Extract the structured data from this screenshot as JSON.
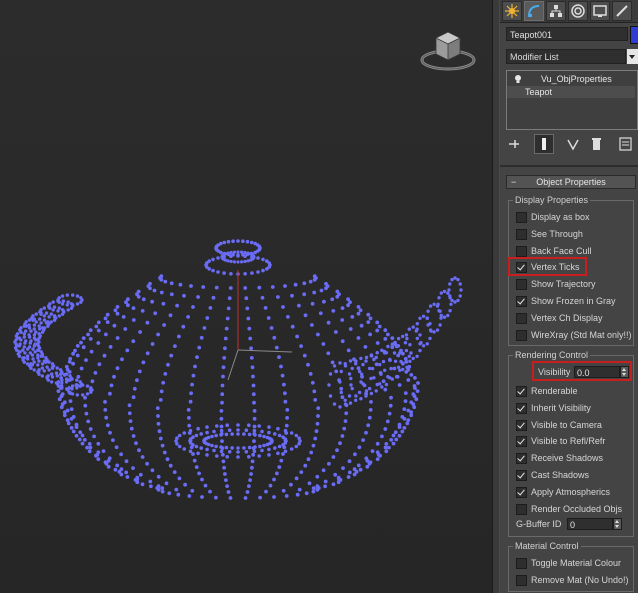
{
  "object": {
    "name": "Teapot001",
    "color": "#2f3dd6"
  },
  "modifier_list": {
    "label": "Modifier List"
  },
  "modifier_stack": {
    "items": [
      {
        "label": "Vu_ObjProperties"
      },
      {
        "label": "Teapot"
      }
    ]
  },
  "rollout": {
    "title": "Object Properties",
    "collapse_glyph": "−"
  },
  "display_properties": {
    "title": "Display Properties",
    "items": [
      {
        "label": "Display as box",
        "checked": false
      },
      {
        "label": "See Through",
        "checked": false
      },
      {
        "label": "Back Face Cull",
        "checked": false
      },
      {
        "label": "Vertex Ticks",
        "checked": true
      },
      {
        "label": "Show Trajectory",
        "checked": false
      },
      {
        "label": "Show Frozen in Gray",
        "checked": true
      },
      {
        "label": "Vertex Ch Display",
        "checked": false
      },
      {
        "label": "WireXray (Std Mat only!!)",
        "checked": false
      }
    ]
  },
  "rendering_control": {
    "title": "Rendering Control",
    "visibility_label": "Visibility",
    "visibility_value": "0.0",
    "items": [
      {
        "label": "Renderable",
        "checked": true
      },
      {
        "label": "Inherit Visibility",
        "checked": true
      },
      {
        "label": "Visible to Camera",
        "checked": true
      },
      {
        "label": "Visible to Refl/Refr",
        "checked": true
      },
      {
        "label": "Receive Shadows",
        "checked": true
      },
      {
        "label": "Cast Shadows",
        "checked": true
      },
      {
        "label": "Apply Atmospherics",
        "checked": true
      },
      {
        "label": "Render Occluded Objs",
        "checked": false
      }
    ],
    "gbuffer_label": "G-Buffer ID",
    "gbuffer_value": "0"
  },
  "material_control": {
    "title": "Material Control",
    "items": [
      {
        "label": "Toggle Material Colour",
        "checked": false
      },
      {
        "label": "Remove Mat (No Undo!)",
        "checked": false
      }
    ]
  },
  "viewport": {
    "vertex_color": "#6a6cf5",
    "viewcube_face_label": ""
  },
  "icons": {
    "tabs": [
      "create-icon",
      "modify-icon",
      "hierarchy-icon",
      "motion-icon",
      "display-icon",
      "utilities-icon"
    ],
    "stack_tools": [
      "pin-stack-icon",
      "show-end-result-icon",
      "make-unique-icon",
      "remove-modifier-icon",
      "configure-modifier-sets-icon"
    ]
  }
}
